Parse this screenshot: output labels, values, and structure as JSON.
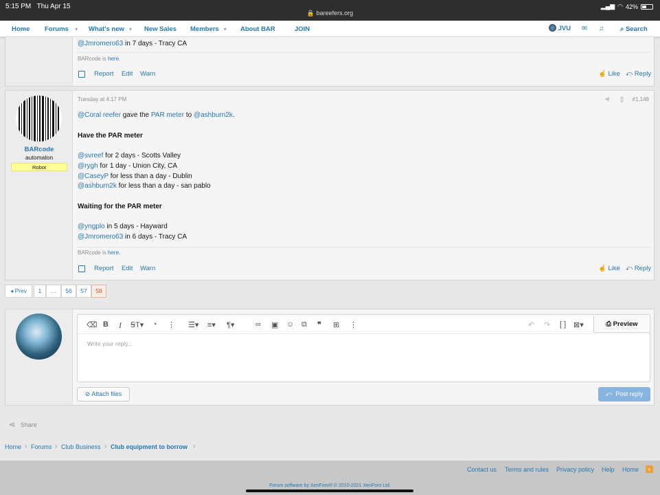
{
  "status": {
    "time": "5:15 PM",
    "date": "Thu Apr 15",
    "url": "bareefers.org",
    "battery": "42%"
  },
  "nav": {
    "home": "Home",
    "forums": "Forums",
    "whats_new": "What's new",
    "new_sales": "New Sales",
    "members": "Members",
    "about": "About BAR",
    "join": "JOIN",
    "user": "JVU",
    "search": "Search"
  },
  "post_prev": {
    "line_user": "@Jmromero63",
    "line_text": " in 7 days - Tracy CA",
    "sig_prefix": "BARcode is ",
    "sig_link": "here."
  },
  "actions": {
    "report": "Report",
    "edit": "Edit",
    "warn": "Warn",
    "like": "Like",
    "reply": "Reply"
  },
  "post_main": {
    "timestamp": "Tuesday at 4:17 PM",
    "post_number": "#1,148",
    "username": "BARcode",
    "user_title": "automaton",
    "banner": "Robot",
    "intro_user": "@Coral reefer",
    "intro_mid": " gave the ",
    "intro_link": "PAR meter",
    "intro_to": " to ",
    "intro_target": "@ashburn2k",
    "intro_end": ".",
    "have_heading": "Have the PAR meter",
    "have": [
      {
        "user": "@svreef",
        "text": " for 2 days - Scotts Valley"
      },
      {
        "user": "@rygh",
        "text": " for 1 day - Union City, CA"
      },
      {
        "user": "@CaseyP",
        "text": " for less than a day - Dublin"
      },
      {
        "user": "@ashburn2k",
        "text": " for less than a day - san pablo"
      }
    ],
    "waiting_heading": "Waiting for the PAR meter",
    "waiting": [
      {
        "user": "@yngplo",
        "text": " in 5 days - Hayward"
      },
      {
        "user": "@Jmromero63",
        "text": " in 6 days - Tracy CA"
      }
    ],
    "sig_prefix": "BARcode is ",
    "sig_link": "here."
  },
  "pagination": {
    "prev": "◂ Prev",
    "pages": [
      "1",
      "…",
      "56",
      "57",
      "58"
    ],
    "current": "58"
  },
  "editor": {
    "placeholder": "Write your reply...",
    "preview": "Preview",
    "attach": "Attach files",
    "post_reply": "Post reply"
  },
  "share": "Share",
  "breadcrumb": [
    "Home",
    "Forums",
    "Club Business",
    "Club equipment to borrow"
  ],
  "footer": {
    "links": [
      "Contact us",
      "Terms and rules",
      "Privacy policy",
      "Help",
      "Home"
    ],
    "copyright": "Forum software by XenForo® © 2010-2021 XenForo Ltd."
  },
  "colors": {
    "link": "#2577b1",
    "banner": "#ffff99",
    "post_reply_button": "#8ab4e0"
  }
}
